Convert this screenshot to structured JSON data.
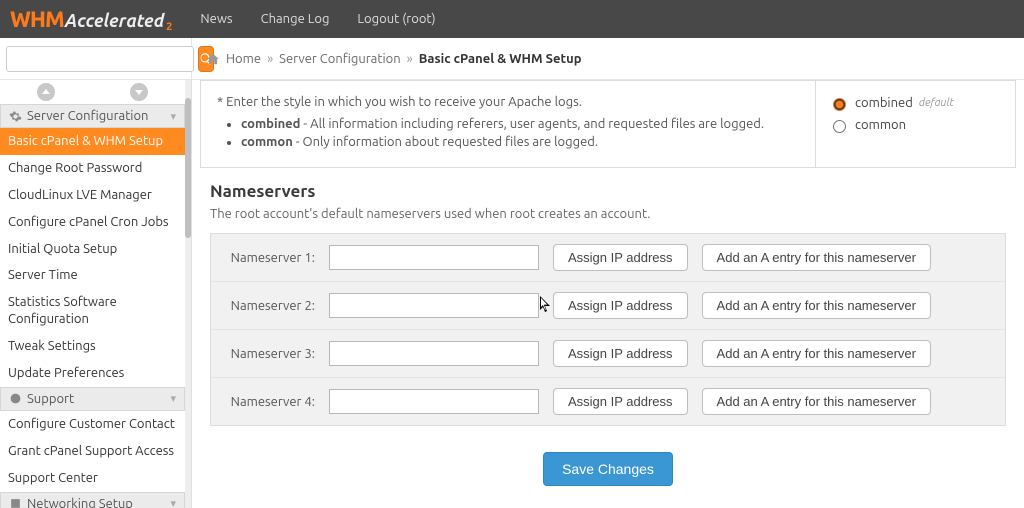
{
  "topnav": {
    "news": "News",
    "changelog": "Change Log",
    "logout": "Logout (root)"
  },
  "logo": {
    "brand": "WHM",
    "sub": "Accelerated",
    "tag": "2"
  },
  "search": {
    "placeholder": ""
  },
  "breadcrumb": {
    "home": "Home",
    "sep": "»",
    "server_config": "Server Configuration",
    "current": "Basic cPanel & WHM Setup"
  },
  "sidebar": {
    "cats": {
      "server_config": "Server Configuration",
      "support": "Support",
      "networking": "Networking Setup"
    },
    "items": {
      "basic": "Basic cPanel & WHM Setup",
      "chroot": "Change Root Password",
      "cloudlinux": "CloudLinux LVE Manager",
      "cron": "Configure cPanel Cron Jobs",
      "quota": "Initial Quota Setup",
      "time": "Server Time",
      "stats": "Statistics Software Configuration",
      "tweak": "Tweak Settings",
      "update": "Update Preferences",
      "cccontact": "Configure Customer Contact",
      "grant": "Grant cPanel Support Access",
      "scenter": "Support Center"
    }
  },
  "apache": {
    "intro": "* Enter the style in which you wish to receive your Apache logs.",
    "combined_name": "combined",
    "combined_desc": " - All information including referers, user agents, and requested files are logged.",
    "common_name": "common",
    "common_desc": " - Only information about requested files are logged.",
    "opt_combined": "combined",
    "opt_default": "default",
    "opt_common": "common"
  },
  "ns": {
    "heading": "Nameservers",
    "sub": "The root account's default nameservers used when root creates an account.",
    "rows": [
      {
        "label": "Nameserver 1:",
        "value": ""
      },
      {
        "label": "Nameserver 2:",
        "value": ""
      },
      {
        "label": "Nameserver 3:",
        "value": ""
      },
      {
        "label": "Nameserver 4:",
        "value": ""
      }
    ],
    "assign": "Assign IP address",
    "aentry": "Add an A entry for this nameserver"
  },
  "save": "Save Changes"
}
